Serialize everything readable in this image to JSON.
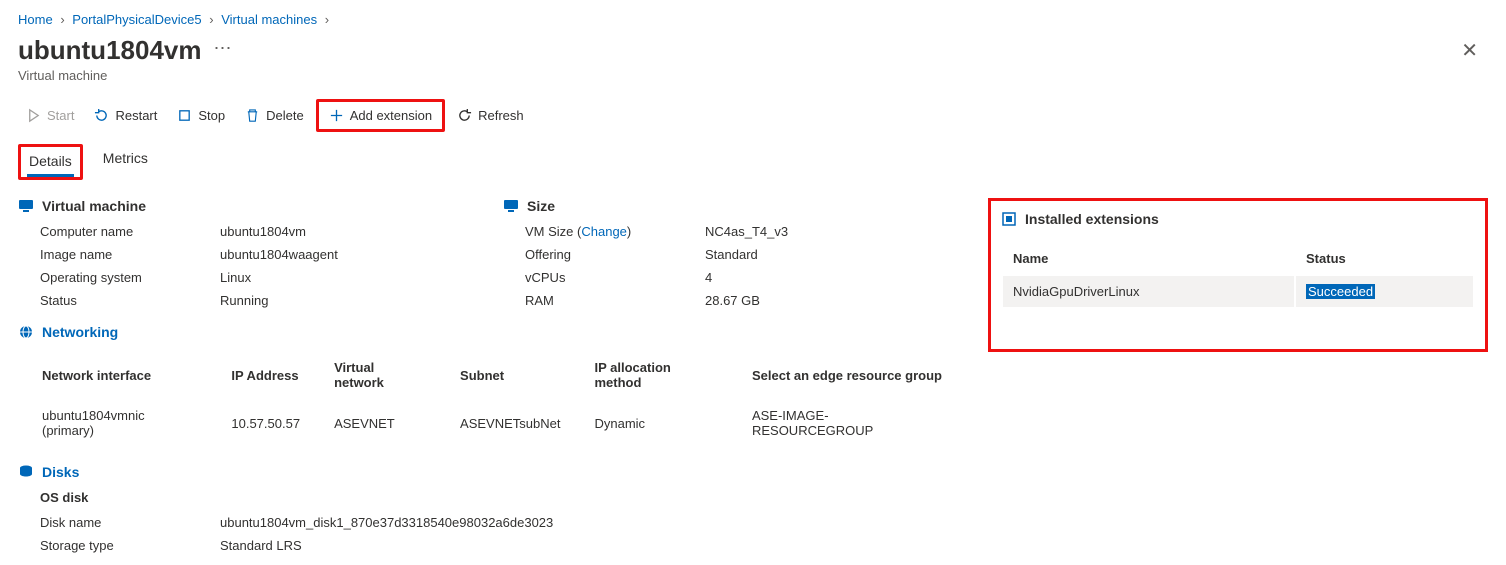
{
  "breadcrumb": {
    "home": "Home",
    "device": "PortalPhysicalDevice5",
    "vms": "Virtual machines"
  },
  "title": "ubuntu1804vm",
  "subtitle": "Virtual machine",
  "toolbar": {
    "start": "Start",
    "restart": "Restart",
    "stop": "Stop",
    "delete": "Delete",
    "add_ext": "Add extension",
    "refresh": "Refresh"
  },
  "tabs": {
    "details": "Details",
    "metrics": "Metrics"
  },
  "vm_section": {
    "heading": "Virtual machine",
    "labels": {
      "cname": "Computer name",
      "iname": "Image name",
      "os": "Operating system",
      "status": "Status"
    },
    "values": {
      "cname": "ubuntu1804vm",
      "iname": "ubuntu1804waagent",
      "os": "Linux",
      "status": "Running"
    }
  },
  "size_section": {
    "heading": "Size",
    "labels": {
      "size": "VM Size",
      "change": "Change",
      "offering": "Offering",
      "vcpus": "vCPUs",
      "ram": "RAM"
    },
    "values": {
      "size": "NC4as_T4_v3",
      "offering": "Standard",
      "vcpus": "4",
      "ram": "28.67 GB"
    }
  },
  "ext": {
    "heading": "Installed extensions",
    "col_name": "Name",
    "col_status": "Status",
    "row_name": "NvidiaGpuDriverLinux",
    "row_status": "Succeeded"
  },
  "net": {
    "heading": "Networking",
    "cols": {
      "iface": "Network interface",
      "ip": "IP Address",
      "vnet": "Virtual network",
      "subnet": "Subnet",
      "alloc": "IP allocation method",
      "rg": "Select an edge resource group"
    },
    "row": {
      "iface": "ubuntu1804vmnic (primary)",
      "ip": "10.57.50.57",
      "vnet": "ASEVNET",
      "subnet": "ASEVNETsubNet",
      "alloc": "Dynamic",
      "rg": "ASE-IMAGE-RESOURCEGROUP"
    }
  },
  "disks": {
    "heading": "Disks",
    "osdisk": "OS disk",
    "labels": {
      "dname": "Disk name",
      "stype": "Storage type"
    },
    "values": {
      "dname": "ubuntu1804vm_disk1_870e37d3318540e98032a6de3023",
      "stype": "Standard LRS"
    }
  }
}
